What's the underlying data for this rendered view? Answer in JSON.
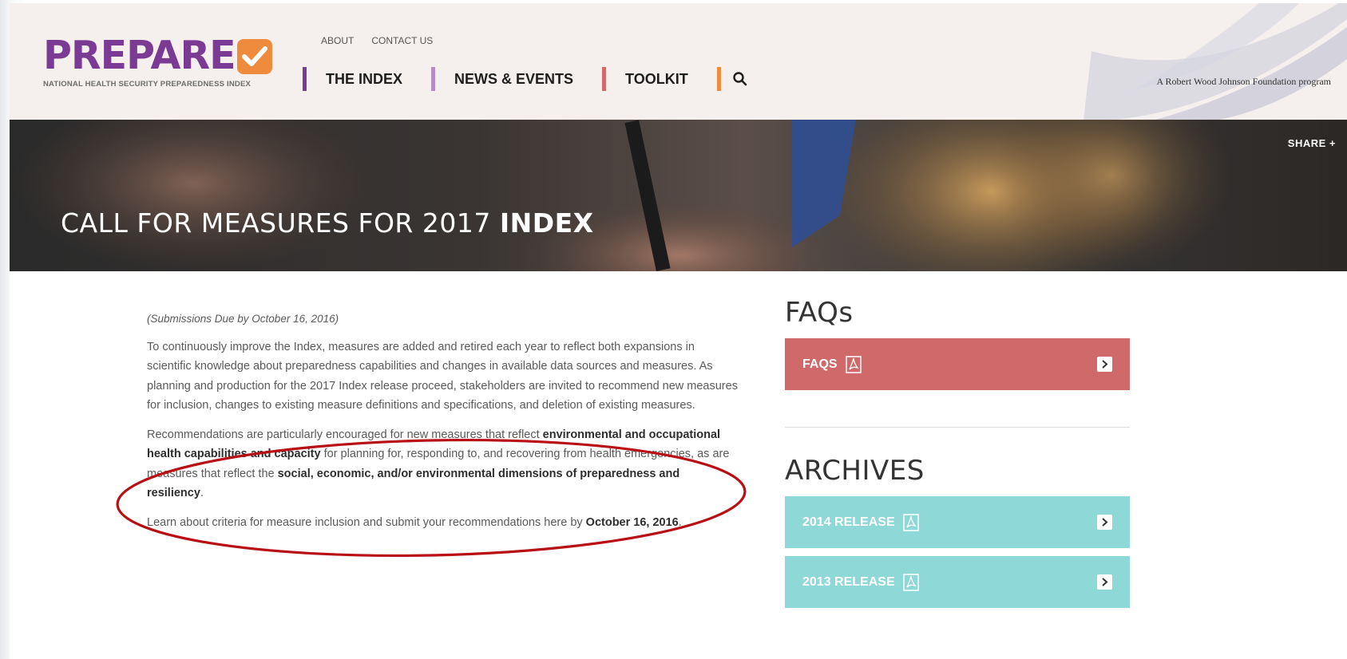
{
  "header": {
    "logo_text": "PREPARE",
    "logo_sub": "NATIONAL HEALTH SECURITY PREPAREDNESS INDEX",
    "top_links": [
      "ABOUT",
      "CONTACT US"
    ],
    "nav": [
      "THE INDEX",
      "NEWS & EVENTS",
      "TOOLKIT"
    ],
    "tagline": "A Robert Wood Johnson Foundation program"
  },
  "hero": {
    "share": "SHARE +",
    "title_light": "CALL FOR MEASURES FOR 2017 ",
    "title_bold": "INDEX"
  },
  "content": {
    "due": "(Submissions Due by October 16, 2016)",
    "p1": "To continuously improve the Index, measures are added and retired each year to reflect both expansions in scientific knowledge about preparedness capabilities and changes in available data sources and measures. As planning and production for the 2017 Index release proceed, stakeholders are invited to recommend new measures for inclusion, changes to existing measure definitions and specifications, and deletion of existing measures.",
    "p2_a": "Recommendations are particularly encouraged for new measures that reflect ",
    "p2_b": "environmental and occupational health capabilities and capacity",
    "p2_c": " for planning for, responding to, and recovering from health emergencies, as are measures that reflect the ",
    "p2_d": "social, economic, and/or environmental dimensions of preparedness and resiliency",
    "p2_e": ".",
    "p3_a": "Learn about criteria for measure inclusion and submit your recommendations here by ",
    "p3_b": "October 16, 2016",
    "p3_c": "."
  },
  "sidebar": {
    "faqs_heading": "FAQs",
    "faqs_panel": "FAQS",
    "archives_heading": "ARCHIVES",
    "archives": [
      "2014 RELEASE",
      "2013 RELEASE"
    ]
  },
  "colors": {
    "brand_purple": "#7b3a93",
    "brand_orange": "#ef8b3c",
    "faq_red": "#d0696a",
    "archive_teal": "#8fd8d8",
    "annotation_red": "#b80f14"
  }
}
